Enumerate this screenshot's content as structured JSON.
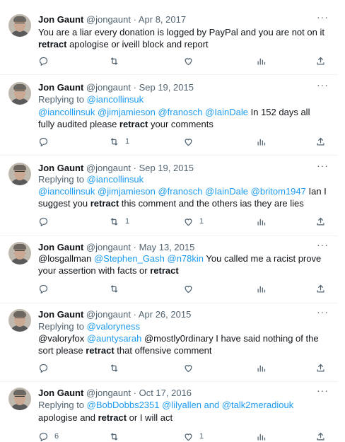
{
  "tweets": [
    {
      "name": "Jon Gaunt",
      "handle": "@jongaunt",
      "date": "Apr 8, 2017",
      "reply_label": "",
      "reply_to": "",
      "body_1": "You are a liar every donation is logged by PayPal and you are not on it",
      "body_2": "retract",
      "body_3": " apologise or iveill block and report",
      "reply_count": "",
      "retweet_count": "",
      "like_count": ""
    },
    {
      "name": "Jon Gaunt",
      "handle": "@jongaunt",
      "date": "Sep 19, 2015",
      "reply_label": "Replying to",
      "reply_to": "@iancollinsuk",
      "mentions": "@iancollinsuk @jimjamieson @franosch @IainDale",
      "body_1": " In 152 days all fully audited please ",
      "body_2": "retract",
      "body_3": " your comments",
      "reply_count": "",
      "retweet_count": "1",
      "like_count": ""
    },
    {
      "name": "Jon Gaunt",
      "handle": "@jongaunt",
      "date": "Sep 19, 2015",
      "reply_label": "Replying to",
      "reply_to": "@iancollinsuk",
      "mentions": "@iancollinsuk @jimjamieson @franosch @IainDale @britom1947",
      "body_1": " Ian I suggest you ",
      "body_2": "retract",
      "body_3": " this comment and the others ias they are lies",
      "reply_count": "",
      "retweet_count": "1",
      "like_count": "1"
    },
    {
      "name": "Jon Gaunt",
      "handle": "@jongaunt",
      "date": "May 13, 2015",
      "reply_label": "",
      "reply_to": "",
      "prefix": "@losgallman ",
      "mentions": "@Stephen_Gash @n78kin",
      "body_1": " You called me a racist prove your assertion with facts or ",
      "body_2": "retract",
      "body_3": "",
      "reply_count": "",
      "retweet_count": "",
      "like_count": ""
    },
    {
      "name": "Jon Gaunt",
      "handle": "@jongaunt",
      "date": "Apr 26, 2015",
      "reply_label": "Replying to",
      "reply_to": "@valoryness",
      "prefix": "@valoryfox ",
      "mentions": "@auntysarah",
      "body_1": " @mostly0rdinary I have said nothing of the sort please ",
      "body_2": "retract",
      "body_3": " that offensive comment",
      "reply_count": "",
      "retweet_count": "",
      "like_count": ""
    },
    {
      "name": "Jon Gaunt",
      "handle": "@jongaunt",
      "date": "Oct 17, 2016",
      "reply_label": "Replying to",
      "reply_to": "@BobDobbs2351 @lilyallen and @talk2meradiouk",
      "body_1": "apologise and ",
      "body_2": "retract",
      "body_3": " or I will act",
      "reply_count": "6",
      "retweet_count": "",
      "like_count": "1"
    }
  ],
  "icons": {
    "reply": "reply-icon",
    "retweet": "retweet-icon",
    "like": "like-icon",
    "views": "views-icon",
    "share": "share-icon",
    "more": "more-icon"
  }
}
